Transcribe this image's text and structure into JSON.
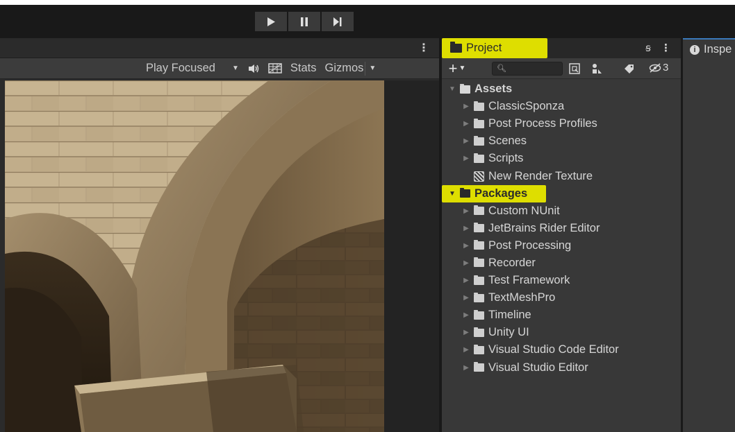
{
  "toolbar": {
    "play_icon": "play-icon",
    "pause_icon": "pause-icon",
    "step_icon": "step-icon"
  },
  "game_view": {
    "play_mode": "Play Focused",
    "stats_label": "Stats",
    "gizmos_label": "Gizmos"
  },
  "project": {
    "tab_label": "Project",
    "hidden_count": "3",
    "tree": [
      {
        "label": "Assets",
        "level": 0,
        "expanded": true,
        "kind": "folder"
      },
      {
        "label": "ClassicSponza",
        "level": 1,
        "kind": "folder"
      },
      {
        "label": "Post Process Profiles",
        "level": 1,
        "kind": "folder"
      },
      {
        "label": "Scenes",
        "level": 1,
        "kind": "folder"
      },
      {
        "label": "Scripts",
        "level": 1,
        "kind": "folder"
      },
      {
        "label": "New Render Texture",
        "level": 1,
        "kind": "render-texture"
      },
      {
        "label": "Packages",
        "level": 0,
        "expanded": true,
        "kind": "folder",
        "highlighted": true
      },
      {
        "label": "Custom NUnit",
        "level": 1,
        "kind": "folder"
      },
      {
        "label": "JetBrains Rider Editor",
        "level": 1,
        "kind": "folder"
      },
      {
        "label": "Post Processing",
        "level": 1,
        "kind": "folder"
      },
      {
        "label": "Recorder",
        "level": 1,
        "kind": "folder"
      },
      {
        "label": "Test Framework",
        "level": 1,
        "kind": "folder"
      },
      {
        "label": "TextMeshPro",
        "level": 1,
        "kind": "folder"
      },
      {
        "label": "Timeline",
        "level": 1,
        "kind": "folder"
      },
      {
        "label": "Unity UI",
        "level": 1,
        "kind": "folder"
      },
      {
        "label": "Visual Studio Code Editor",
        "level": 1,
        "kind": "folder"
      },
      {
        "label": "Visual Studio Editor",
        "level": 1,
        "kind": "folder"
      }
    ]
  },
  "inspector": {
    "tab_label": "Inspe"
  },
  "colors": {
    "highlight": "#dede00",
    "panel": "#383838",
    "toolbar": "#3c3c3c",
    "background": "#191919",
    "inspector_accent": "#3a79bb"
  }
}
